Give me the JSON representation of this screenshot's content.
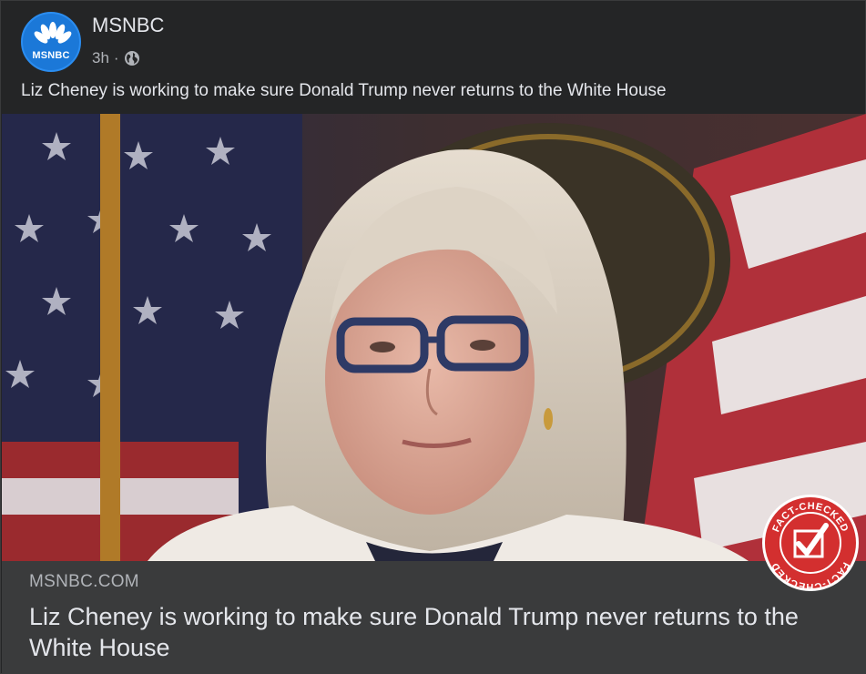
{
  "post": {
    "page_name": "MSNBC",
    "avatar_label": "MSNBC",
    "time": "3h",
    "separator": "·",
    "audience_icon": "globe-icon",
    "text": "Liz Cheney is working to make sure Donald Trump never returns to the White House"
  },
  "link": {
    "domain": "MSNBC.COM",
    "title": "Liz Cheney is working to make sure Donald Trump never returns to the White House"
  },
  "badge": {
    "top_text": "FACT-CHECKED",
    "bottom_text": "FACT-CHECKED",
    "icon": "checkmark-icon"
  },
  "colors": {
    "background": "#242526",
    "link_bg": "#3a3b3c",
    "text_primary": "#e4e6eb",
    "text_secondary": "#b0b3b8",
    "avatar_blue": "#1b78d8",
    "badge_red": "#d32f2f"
  }
}
